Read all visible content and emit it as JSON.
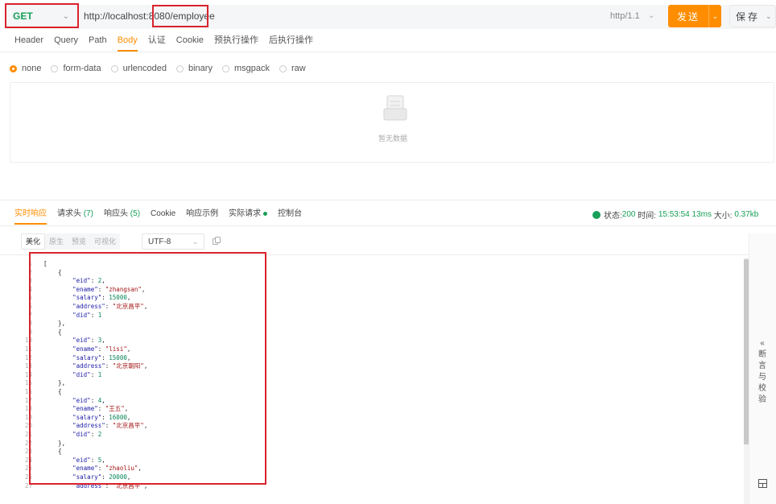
{
  "request": {
    "method": "GET",
    "url": "http://localhost:8080/employee",
    "protocol": "http/1.1",
    "send_label": "发送",
    "save_label": "保存"
  },
  "request_tabs": [
    "Header",
    "Query",
    "Path",
    "Body",
    "认证",
    "Cookie",
    "预执行操作",
    "后执行操作"
  ],
  "active_request_tab": "Body",
  "body_types": [
    "none",
    "form-data",
    "urlencoded",
    "binary",
    "msgpack",
    "raw"
  ],
  "selected_body_type": "none",
  "empty_text": "暂无数据",
  "response_tabs": [
    {
      "label": "实时响应",
      "count": ""
    },
    {
      "label": "请求头",
      "count": "(7)"
    },
    {
      "label": "响应头",
      "count": "(5)"
    },
    {
      "label": "Cookie",
      "count": ""
    },
    {
      "label": "响应示例",
      "count": ""
    },
    {
      "label": "实际请求",
      "count": ""
    },
    {
      "label": "控制台",
      "count": ""
    }
  ],
  "status": {
    "status_label": "状态:",
    "status_code": "200",
    "time_label": "时间:",
    "time_value": "15:53:54",
    "duration": "13ms",
    "size_label": "大小:",
    "size_value": "0.37kb"
  },
  "view_modes": [
    "美化",
    "原生",
    "预览",
    "可视化"
  ],
  "active_view_mode": "美化",
  "encoding": "UTF-8",
  "side_panel_label": "断言与校验",
  "side_panel_expand": "«",
  "colors": {
    "accent": "#ff8d00",
    "success": "#18a058",
    "highlight": "#d9232d"
  },
  "code_lines": [
    "[",
    "    {",
    "        \"eid\": 2,",
    "        \"ename\": \"zhangsan\",",
    "        \"salary\": 15000,",
    "        \"address\": \"北京昌平\",",
    "        \"did\": 1",
    "    },",
    "    {",
    "        \"eid\": 3,",
    "        \"ename\": \"lisi\",",
    "        \"salary\": 15000,",
    "        \"address\": \"北京朝阳\",",
    "        \"did\": 1",
    "    },",
    "    {",
    "        \"eid\": 4,",
    "        \"ename\": \"王五\",",
    "        \"salary\": 16000,",
    "        \"address\": \"北京昌平\",",
    "        \"did\": 2",
    "    },",
    "    {",
    "        \"eid\": 5,",
    "        \"ename\": \"zhaoliu\",",
    "        \"salary\": 20000,",
    "        \"address\": \"北京昌平\","
  ]
}
